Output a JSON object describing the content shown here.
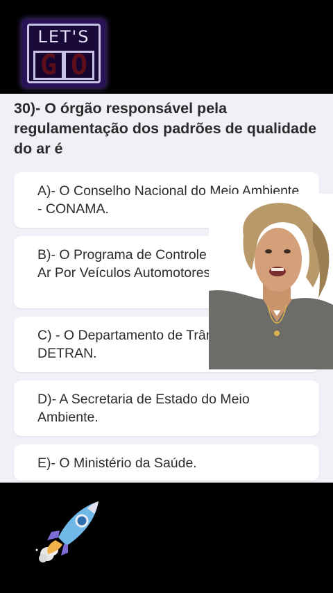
{
  "logo": {
    "top": "LET'S",
    "bottom": [
      "G",
      "O"
    ]
  },
  "question": {
    "text": "30)- O órgão responsável pela regulamentação dos padrões de qualidade do ar é"
  },
  "options": [
    {
      "label": "A)- O Conselho Nacional do Meio Ambiente - CONAMA."
    },
    {
      "label": "B)- O Programa de Controle da Poluição do Ar Por Veículos Automotores - PROCONVE."
    },
    {
      "label": "C) - O Departamento de Trânsito - DETRAN."
    },
    {
      "label": "D)- A Secretaria de Estado do Meio Ambiente."
    },
    {
      "label": "E)- O Ministério da Saúde."
    }
  ]
}
